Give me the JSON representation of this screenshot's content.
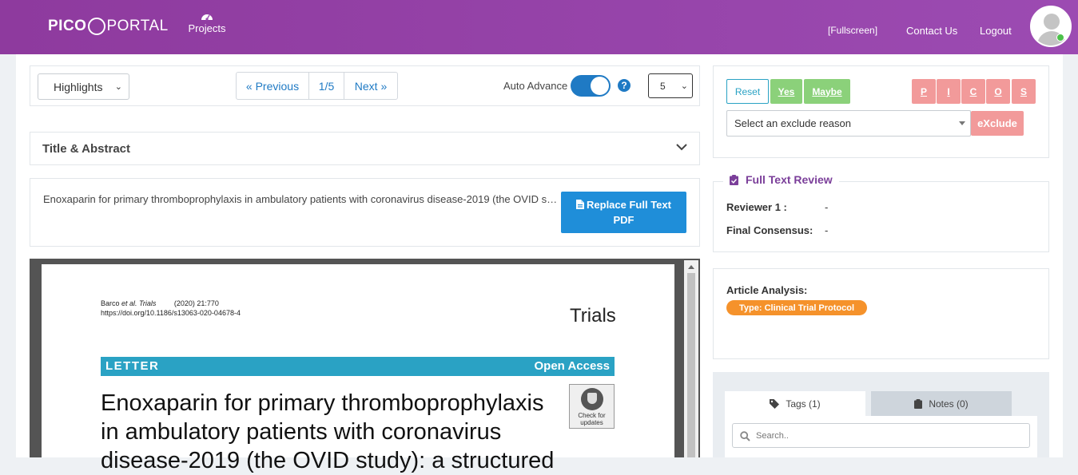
{
  "header": {
    "logo_part1": "PICO",
    "logo_part2": "PORTAL",
    "nav_projects": "Projects",
    "fullscreen": "Fullscreen",
    "contact": "Contact Us",
    "logout": "Logout"
  },
  "toolbar": {
    "highlights": "Highlights",
    "prev": "« Previous",
    "page": "1/5",
    "next": "Next »",
    "auto_advance": "Auto Advance",
    "auto_advance_on": true,
    "help": "?",
    "per_page": "5"
  },
  "title_abstract": {
    "label": "Title & Abstract"
  },
  "article": {
    "title": "Enoxaparin for primary thromboprophylaxis in ambulatory patients with coronavirus disease-2019 (the OVID study): a structured summary of a study protocol for a randomized controlled trial",
    "replace_line1": "Replace Full Text",
    "replace_line2": "PDF"
  },
  "pdf": {
    "cite_authors": "Barco",
    "cite_etal": "et al. Trials",
    "cite_year": "(2020) 21:770",
    "cite_doi": "https://doi.org/10.1186/s13063-020-04678-4",
    "journal": "Trials",
    "bar_left": "LETTER",
    "bar_right": "Open Access",
    "heading_l1": "Enoxaparin for primary thromboprophylaxis",
    "heading_l2": "in ambulatory patients with coronavirus",
    "heading_l3": "disease-2019 (the OVID study): a structured",
    "check_l1": "Check for",
    "check_l2": "updates"
  },
  "decision": {
    "reset": "Reset",
    "yes": "Yes",
    "maybe": "Maybe",
    "pico": [
      "P",
      "I",
      "C",
      "O",
      "S"
    ],
    "exclude_placeholder": "Select an exclude reason",
    "exclude": "eXclude"
  },
  "review": {
    "title": "Full Text Review",
    "reviewer_label": "Reviewer 1 :",
    "reviewer_value": "-",
    "consensus_label": "Final Consensus:",
    "consensus_value": "-"
  },
  "analysis": {
    "title": "Article Analysis:",
    "badge": "Type: Clinical Trial Protocol"
  },
  "tabs": {
    "tags": "Tags (1)",
    "notes": "Notes (0)",
    "search_placeholder": "Search.."
  },
  "colors": {
    "header": "#9c4bb2",
    "primary": "#1f7ac4",
    "green": "#8bd17a",
    "pink": "#f29a9a",
    "orange": "#f5922b",
    "purple_text": "#7b3f9a"
  }
}
